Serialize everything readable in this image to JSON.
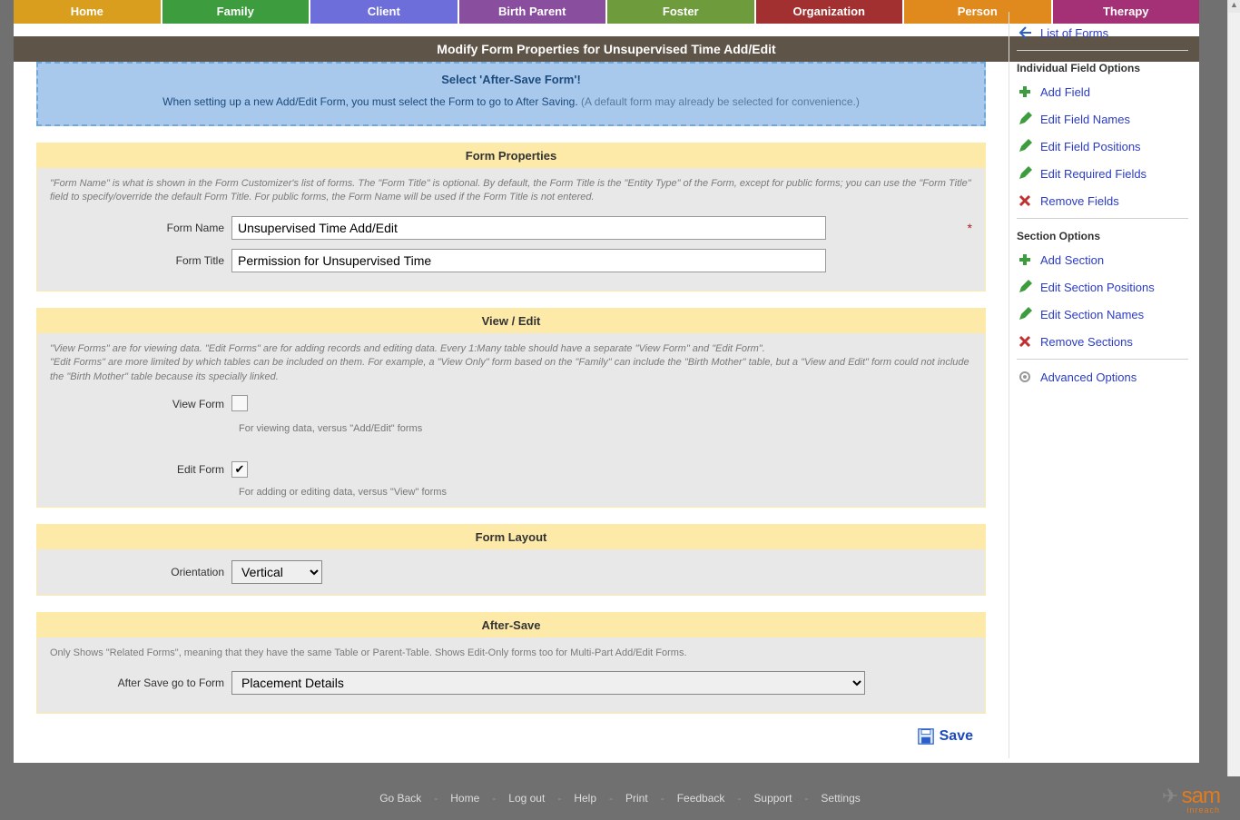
{
  "nav": {
    "items": [
      {
        "label": "Home",
        "cls": "tab-home"
      },
      {
        "label": "Family",
        "cls": "tab-family"
      },
      {
        "label": "Client",
        "cls": "tab-client"
      },
      {
        "label": "Birth Parent",
        "cls": "tab-birth"
      },
      {
        "label": "Foster",
        "cls": "tab-foster"
      },
      {
        "label": "Organization",
        "cls": "tab-org"
      },
      {
        "label": "Person",
        "cls": "tab-person"
      },
      {
        "label": "Therapy",
        "cls": "tab-therapy"
      }
    ]
  },
  "title": "Modify Form Properties for Unsupervised Time Add/Edit",
  "alert": {
    "heading": "Select 'After-Save Form'!",
    "text_main": "When setting up a new Add/Edit Form, you must select the Form to go to After Saving. ",
    "text_sub": "(A default form may already be selected for convenience.)"
  },
  "sections": {
    "properties": {
      "title": "Form Properties",
      "help": "\"Form Name\" is what is shown in the Form Customizer's list of forms. The \"Form Title\" is optional. By default, the Form Title is the \"Entity Type\" of the Form, except for public forms; you can use the \"Form Title\" field to specify/override the default Form Title. For public forms, the Form Name will be used if the Form Title is not entered.",
      "form_name_label": "Form Name",
      "form_name_value": "Unsupervised Time Add/Edit",
      "form_title_label": "Form Title",
      "form_title_value": "Permission for Unsupervised Time"
    },
    "viewedit": {
      "title": "View / Edit",
      "help": "\"View Forms\" are for viewing data. \"Edit Forms\" are for adding records and editing data. Every 1:Many table should have a separate \"View Form\" and \"Edit Form\".\n\"Edit Forms\" are more limited by which tables can be included on them. For example, a \"View Only\" form based on the \"Family\" can include the \"Birth Mother\" table, but a \"View and Edit\" form could not include the \"Birth Mother\" table because its specially linked.",
      "view_label": "View Form",
      "view_checked": false,
      "view_hint": "For viewing data, versus \"Add/Edit\" forms",
      "edit_label": "Edit Form",
      "edit_checked": true,
      "edit_hint": "For adding or editing data, versus \"View\" forms"
    },
    "layout": {
      "title": "Form Layout",
      "orient_label": "Orientation",
      "orient_value": "Vertical"
    },
    "aftersave": {
      "title": "After-Save",
      "help": "Only Shows \"Related Forms\", meaning that they have the same Table or Parent-Table. Shows Edit-Only forms too for Multi-Part Add/Edit Forms.",
      "field_label": "After Save go to Form",
      "value": "Placement Details"
    }
  },
  "save_label": "Save",
  "sidebar": {
    "list_forms": "List of Forms",
    "group1_head": "Individual Field Options",
    "add_field": "Add Field",
    "edit_field_names": "Edit Field Names",
    "edit_field_positions": "Edit Field Positions",
    "edit_required": "Edit Required Fields",
    "remove_fields": "Remove Fields",
    "group2_head": "Section Options",
    "add_section": "Add Section",
    "edit_section_positions": "Edit Section Positions",
    "edit_section_names": "Edit Section Names",
    "remove_sections": "Remove Sections",
    "advanced": "Advanced Options"
  },
  "footer": {
    "items": [
      "Go Back",
      "Home",
      "Log out",
      "Help",
      "Print",
      "Feedback",
      "Support",
      "Settings"
    ]
  },
  "logo": {
    "top": "sam",
    "bot": "inreach"
  }
}
